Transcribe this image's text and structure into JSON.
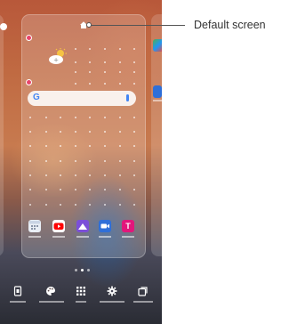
{
  "annotation": {
    "label": "Default screen"
  },
  "colors": {
    "remove_badge": "#e8456a",
    "google_blue": "#4285f4"
  },
  "home_screen": {
    "weather_widget": {
      "icon": "weather-partly-cloudy-icon"
    },
    "search_bar": {
      "logo": "G",
      "icon": "microphone-icon"
    },
    "dock_apps": [
      {
        "name": "app-1",
        "icon": "calendar-icon"
      },
      {
        "name": "app-2",
        "icon": "youtube-icon"
      },
      {
        "name": "app-3",
        "icon": "gallery-icon"
      },
      {
        "name": "app-4",
        "icon": "video-icon"
      },
      {
        "name": "app-5",
        "icon": "t-mobile-icon",
        "glyph": "T"
      }
    ],
    "toolbar": [
      {
        "icon": "remove-page-icon"
      },
      {
        "icon": "wallpaper-palette-icon"
      },
      {
        "icon": "apps-grid-icon"
      },
      {
        "icon": "settings-gear-icon"
      },
      {
        "icon": "widgets-icon"
      }
    ]
  }
}
